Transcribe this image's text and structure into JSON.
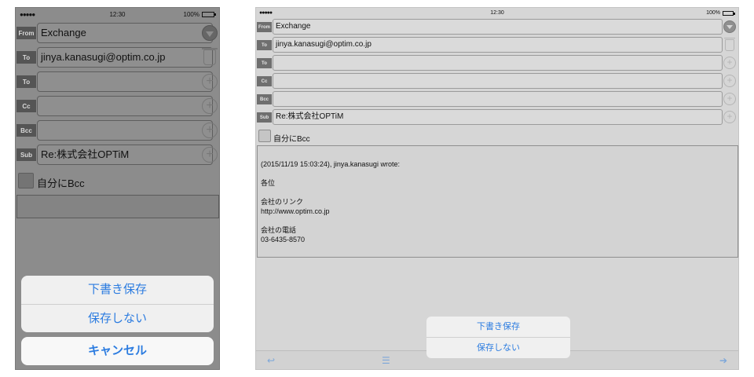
{
  "phone": {
    "status": {
      "signal": "●●●●●",
      "time": "12:30",
      "battery": "100%"
    },
    "fields": [
      {
        "tag": "From",
        "value": "Exchange",
        "button": "dropdown-icon"
      },
      {
        "tag": "To",
        "value": "jinya.kanasugi@optim.co.jp",
        "button": "trash-icon"
      },
      {
        "tag": "To",
        "value": "",
        "button": "plus-icon"
      },
      {
        "tag": "Cc",
        "value": "",
        "button": "plus-icon"
      },
      {
        "tag": "Bcc",
        "value": "",
        "button": "plus-icon"
      },
      {
        "tag": "Sub",
        "value": "Re:株式会社OPTiM",
        "button": "plus-icon"
      }
    ],
    "bcc_self_label": "自分にBcc",
    "action_sheet": {
      "save_draft": "下書き保存",
      "dont_save": "保存しない",
      "cancel": "キャンセル"
    }
  },
  "tablet": {
    "status": {
      "signal": "●●●●●",
      "time": "12:30",
      "battery": "100%"
    },
    "fields": [
      {
        "tag": "From",
        "value": "Exchange",
        "button": "dropdown-icon"
      },
      {
        "tag": "To",
        "value": "jinya.kanasugi@optim.co.jp",
        "button": "trash-icon"
      },
      {
        "tag": "To",
        "value": "",
        "button": "plus-icon"
      },
      {
        "tag": "Cc",
        "value": "",
        "button": "plus-icon"
      },
      {
        "tag": "Bcc",
        "value": "",
        "button": "plus-icon"
      },
      {
        "tag": "Sub",
        "value": "Re:株式会社OPTiM",
        "button": "plus-icon"
      }
    ],
    "bcc_self_label": "自分にBcc",
    "body": {
      "line1": "(2015/11/19 15:03:24), jinya.kanasugi wrote:",
      "line2": "各位",
      "line3": "会社のリンク",
      "line4": "http://www.optim.co.jp",
      "line5": "会社の電話",
      "line6": "03-6435-8570"
    },
    "popover": {
      "save_draft": "下書き保存",
      "dont_save": "保存しない"
    },
    "toolbar": {
      "left_icon": "undo-icon",
      "center_icon": "list-icon",
      "right_icon": "send-icon"
    }
  },
  "colors": {
    "accent": "#2c7ce0",
    "phone_dim_bg": "#8c8c8c",
    "tablet_bg": "#d6d6d6"
  }
}
